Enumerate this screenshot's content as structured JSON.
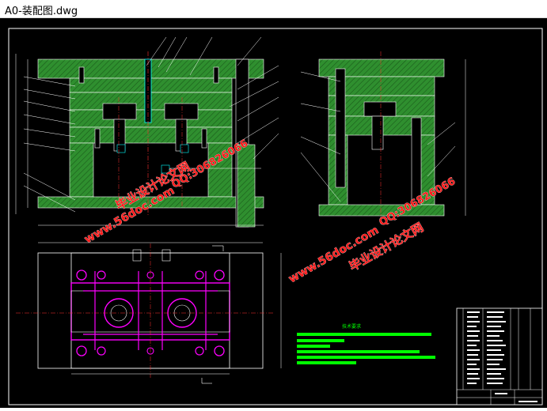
{
  "window": {
    "title": "A0-装配图.dwg"
  },
  "colors": {
    "background": "#000000",
    "frame": "#ffffff",
    "hatch": "#2f8f2f",
    "hatch_dark": "#1f6f1f",
    "magenta": "#ff00ff",
    "red": "#ff3030",
    "cyan": "#00ffff",
    "yellow": "#ffff00",
    "green_text": "#00ff00",
    "watermark": "#ff1a1a"
  },
  "notes": {
    "heading": "技术要求"
  },
  "watermarks": {
    "site_1": "www.56doc.com",
    "qq_1": "QQ:306826066",
    "brand_1": "毕业设计论文网",
    "site_2": "www.56doc.com",
    "brand_2": "毕业设计论文网",
    "qq_2": "QQ:306826066",
    "site_3": "www.56doc.com",
    "qq_3": "QQ:306826066",
    "brand_3": "毕业设计论文网"
  }
}
